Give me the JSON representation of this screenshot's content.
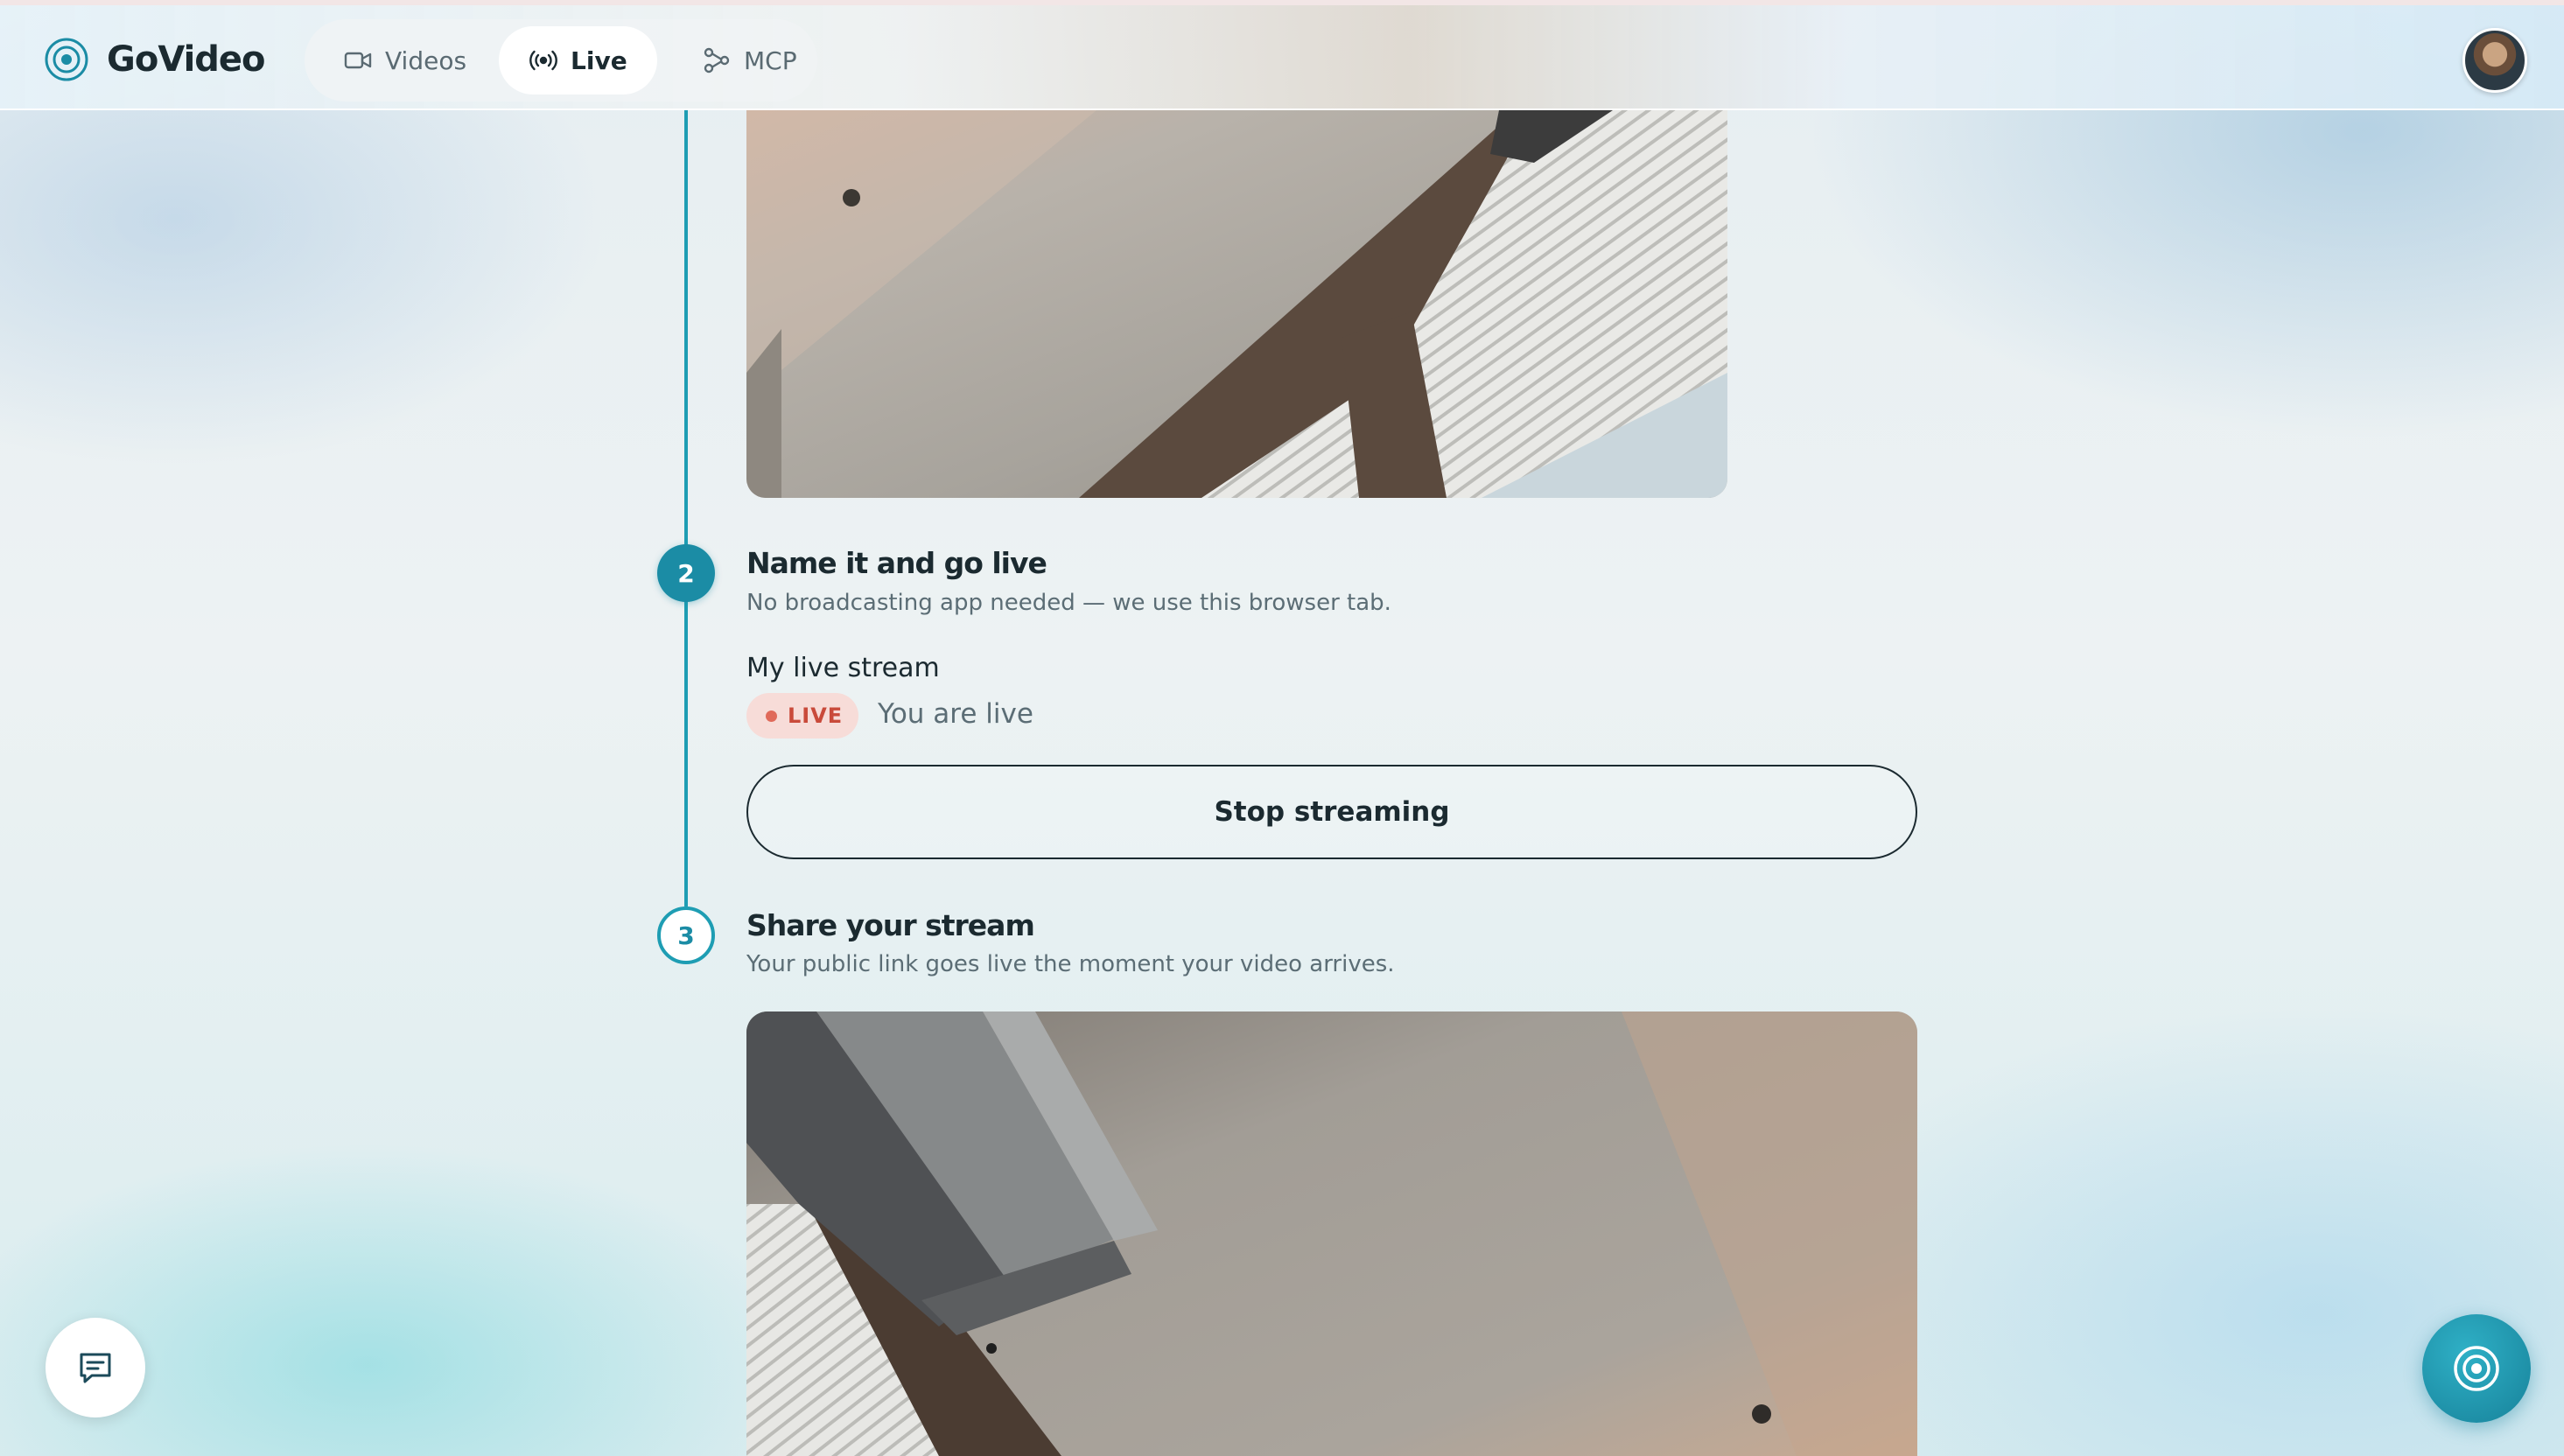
{
  "app": {
    "name": "GoVideo"
  },
  "nav": {
    "items": [
      {
        "label": "Videos",
        "icon": "video-camera-icon"
      },
      {
        "label": "Live",
        "icon": "broadcast-icon",
        "active": true
      },
      {
        "label": "MCP",
        "icon": "mcp-nodes-icon"
      }
    ]
  },
  "user": {
    "avatar": "user-avatar"
  },
  "steps": [
    {
      "number": "2",
      "title": "Name it and go live",
      "subtitle": "No broadcasting app needed — we use this browser tab."
    },
    {
      "number": "3",
      "title": "Share your stream",
      "subtitle": "Your public link goes live the moment your video arrives."
    }
  ],
  "stream": {
    "name": "My live stream",
    "badge": "LIVE",
    "status": "You are live",
    "stop_label": "Stop streaming"
  },
  "colors": {
    "accent": "#1b8ca5",
    "live_badge_bg": "#f7dcd8",
    "live_badge_text": "#c94a3a"
  }
}
